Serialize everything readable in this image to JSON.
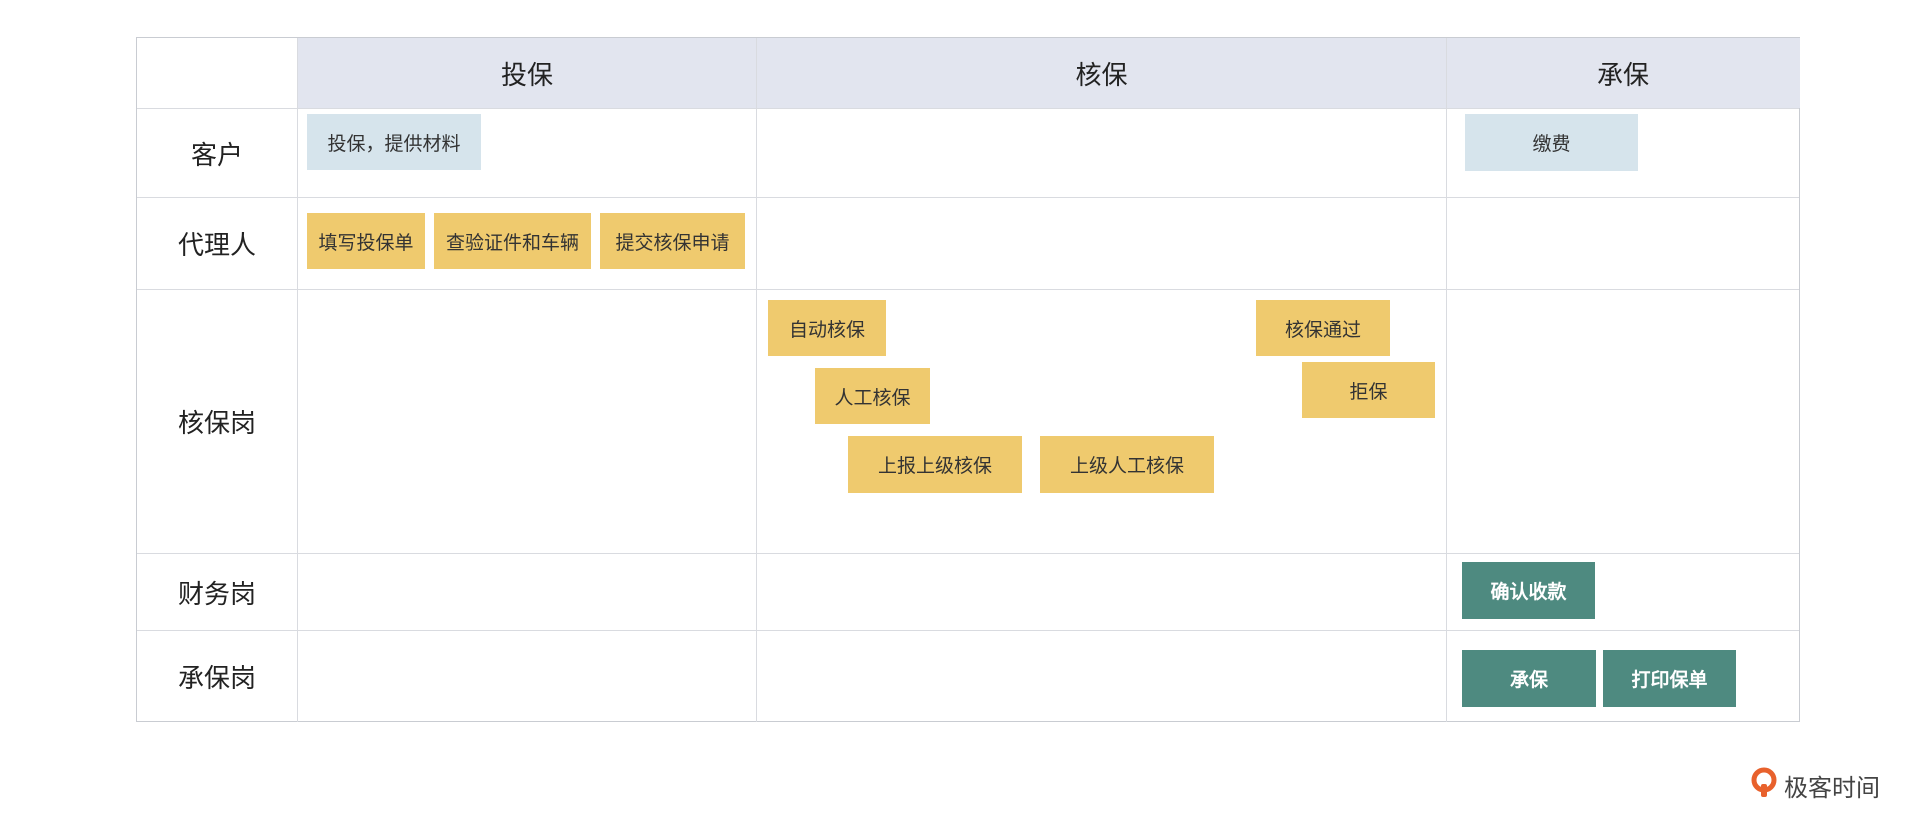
{
  "columns": [
    {
      "id": "apply",
      "label": "投保"
    },
    {
      "id": "review",
      "label": "核保"
    },
    {
      "id": "accept",
      "label": "承保"
    }
  ],
  "rows": [
    {
      "id": "customer",
      "label": "客户"
    },
    {
      "id": "agent",
      "label": "代理人"
    },
    {
      "id": "underwriter",
      "label": "核保岗"
    },
    {
      "id": "finance",
      "label": "财务岗"
    },
    {
      "id": "issuer",
      "label": "承保岗"
    }
  ],
  "cards": {
    "apply_provide": "投保，提供材料",
    "pay_premium": "缴费",
    "fill_form": "填写投保单",
    "inspect": "查验证件和车辆",
    "submit_request": "提交核保申请",
    "auto_review": "自动核保",
    "review_passed": "核保通过",
    "manual_review": "人工核保",
    "reject": "拒保",
    "escalate": "上报上级核保",
    "senior_review": "上级人工核保",
    "confirm_payment": "确认收款",
    "accept_policy": "承保",
    "print_policy": "打印保单"
  },
  "colors": {
    "header_bg": "#e2e5ef",
    "customer_card": "#d6e4ec",
    "work_card": "#efca6e",
    "key_card": "#4e8a80",
    "brand_accent": "#e8612c"
  },
  "brand": {
    "label": "极客时间",
    "icon": "geektime-logo-icon"
  }
}
